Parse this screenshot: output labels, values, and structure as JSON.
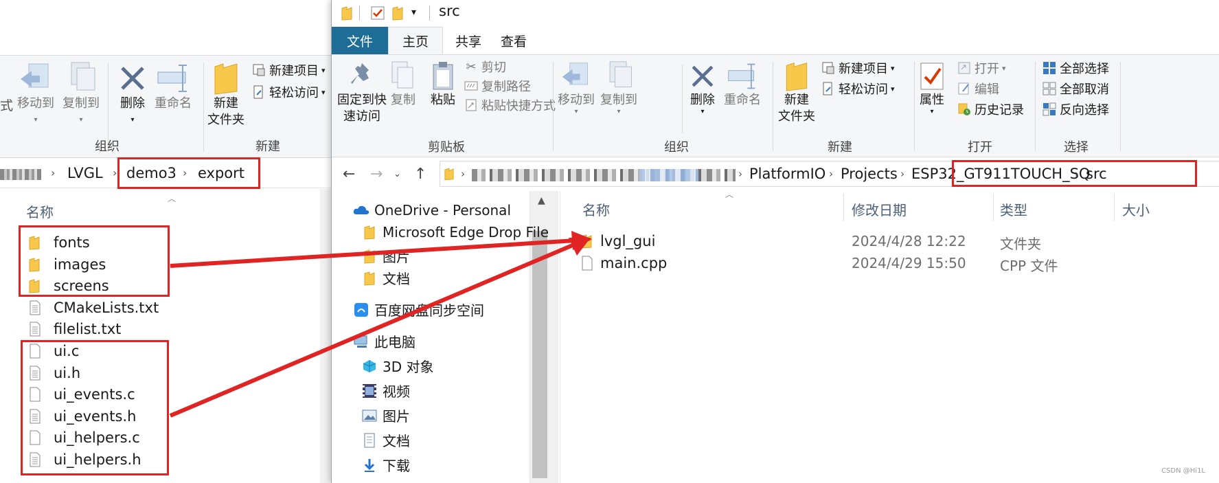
{
  "left_window": {
    "ribbon": {
      "truncated_label": "式",
      "move_to": "移动到",
      "copy_to": "复制到",
      "delete": "删除",
      "rename": "重命名",
      "new_folder_line1": "新建",
      "new_folder_line2": "文件夹",
      "new_item": "新建项目",
      "easy_access": "轻松访问",
      "group_organize": "组织",
      "group_new": "新建"
    },
    "address": {
      "crumbs": [
        "LVGL",
        "demo3",
        "export"
      ]
    },
    "column_name": "名称",
    "files": [
      {
        "name": "fonts",
        "type": "folder"
      },
      {
        "name": "images",
        "type": "folder"
      },
      {
        "name": "screens",
        "type": "folder"
      },
      {
        "name": "CMakeLists.txt",
        "type": "text"
      },
      {
        "name": "filelist.txt",
        "type": "text"
      },
      {
        "name": "ui.c",
        "type": "file"
      },
      {
        "name": "ui.h",
        "type": "text"
      },
      {
        "name": "ui_events.c",
        "type": "file"
      },
      {
        "name": "ui_events.h",
        "type": "text"
      },
      {
        "name": "ui_helpers.c",
        "type": "file"
      },
      {
        "name": "ui_helpers.h",
        "type": "text"
      }
    ]
  },
  "right_window": {
    "title": "src",
    "tabs": {
      "file": "文件",
      "home": "主页",
      "share": "共享",
      "view": "查看"
    },
    "ribbon": {
      "pin_line1": "固定到快",
      "pin_line2": "速访问",
      "copy": "复制",
      "paste": "粘贴",
      "cut": "剪切",
      "copy_path": "复制路径",
      "paste_shortcut": "粘贴快捷方式",
      "group_clipboard": "剪贴板",
      "move_to": "移动到",
      "copy_to": "复制到",
      "delete": "删除",
      "rename": "重命名",
      "group_organize": "组织",
      "new_folder_line1": "新建",
      "new_folder_line2": "文件夹",
      "new_item": "新建项目",
      "easy_access": "轻松访问",
      "group_new": "新建",
      "properties": "属性",
      "open": "打开",
      "edit": "编辑",
      "history": "历史记录",
      "group_open": "打开",
      "select_all": "全部选择",
      "select_none": "全部取消",
      "invert_selection": "反向选择",
      "group_select": "选择"
    },
    "address": {
      "crumbs": [
        "PlatformIO",
        "Projects",
        "ESP32_GT911TOUCH_SQ",
        "src"
      ]
    },
    "nav": {
      "onedrive": "OneDrive - Personal",
      "edge_drop": "Microsoft Edge Drop File",
      "pictures": "图片",
      "documents": "文档",
      "baidu": "百度网盘同步空间",
      "this_pc": "此电脑",
      "objects3d": "3D 对象",
      "videos": "视频",
      "pictures2": "图片",
      "documents2": "文档",
      "downloads": "下载"
    },
    "columns": {
      "name": "名称",
      "modified": "修改日期",
      "type": "类型",
      "size": "大小"
    },
    "files": [
      {
        "name": "lvgl_gui",
        "modified": "2024/4/28 12:22",
        "type": "文件夹",
        "icon": "folder"
      },
      {
        "name": "main.cpp",
        "modified": "2024/4/29 15:50",
        "type": "CPP 文件",
        "icon": "file"
      }
    ]
  },
  "watermark": "CSDN @Hi1L",
  "colors": {
    "annotation_red": "#e02424",
    "file_tab_blue": "#1e6d96",
    "folder_yellow": "#f8c84a"
  }
}
